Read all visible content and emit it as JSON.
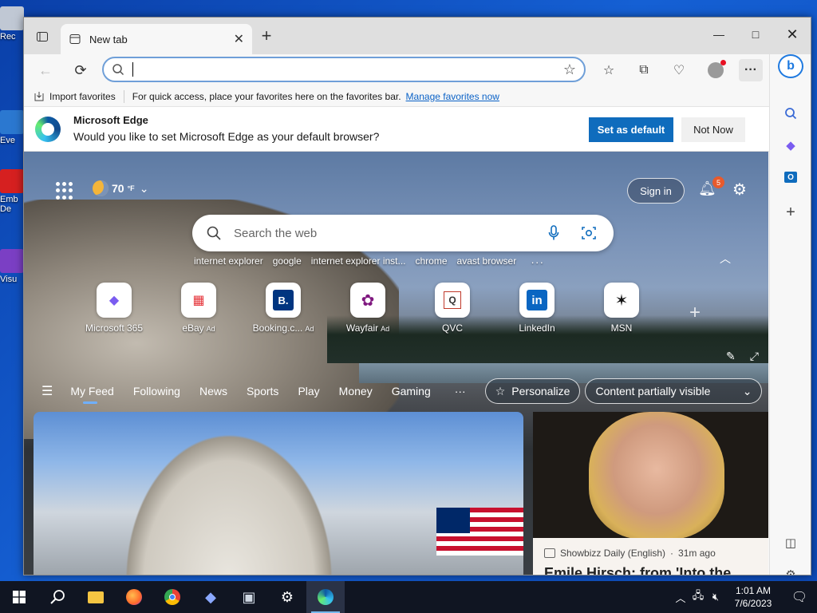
{
  "desktop": {
    "icons": [
      {
        "label": "Rec",
        "color": "#c0c8d4"
      },
      {
        "label": "Eve",
        "color": "#2b78d0"
      },
      {
        "label": "Emb De",
        "color": "#d62020"
      },
      {
        "label": "Visu",
        "color": "#7b3fc4"
      }
    ]
  },
  "browser": {
    "tab": {
      "title": "New tab"
    },
    "omnibox": {
      "value": "",
      "placeholder": ""
    },
    "favorites_bar": {
      "import_label": "Import favorites",
      "hint": "For quick access, place your favorites here on the favorites bar.",
      "manage_link": "Manage favorites now"
    },
    "infobar": {
      "title": "Microsoft Edge",
      "message": "Would you like to set Microsoft Edge as your default browser?",
      "primary_button": "Set as default",
      "secondary_button": "Not Now"
    }
  },
  "newtab": {
    "weather": {
      "temp": "70",
      "unit": "°F"
    },
    "signin_label": "Sign in",
    "notification_count": "5",
    "search": {
      "placeholder": "Search the web"
    },
    "trending": [
      "internet explorer",
      "google",
      "internet explorer inst...",
      "chrome",
      "avast browser"
    ],
    "tiles": [
      {
        "label": "Microsoft 365",
        "ad": "",
        "icon": "microsoft-365-icon",
        "glyph": "◆",
        "color": "#7a5cf0"
      },
      {
        "label": "eBay",
        "ad": "Ad",
        "icon": "ebay-icon",
        "glyph": "▦",
        "color": "#e53238"
      },
      {
        "label": "Booking.c...",
        "ad": "Ad",
        "icon": "booking-icon",
        "glyph": "B.",
        "color": "#003580"
      },
      {
        "label": "Wayfair",
        "ad": "Ad",
        "icon": "wayfair-icon",
        "glyph": "✿",
        "color": "#7f187f"
      },
      {
        "label": "QVC",
        "ad": "",
        "icon": "qvc-icon",
        "glyph": "Q",
        "color": "#c0392b"
      },
      {
        "label": "LinkedIn",
        "ad": "",
        "icon": "linkedin-icon",
        "glyph": "in",
        "color": "#0a66c2"
      },
      {
        "label": "MSN",
        "ad": "",
        "icon": "msn-icon",
        "glyph": "✶",
        "color": "#111111"
      }
    ],
    "feed_nav": {
      "items": [
        "My Feed",
        "Following",
        "News",
        "Sports",
        "Play",
        "Money",
        "Gaming"
      ],
      "active": "My Feed",
      "personalize": "Personalize",
      "visibility": "Content partially visible"
    },
    "cards": [
      {
        "source": "Showbizz Daily (English)",
        "age": "31m ago",
        "headline": "Emile Hirsch: from 'Into the"
      }
    ]
  },
  "taskbar": {
    "time": "1:01 AM",
    "date": "7/6/2023"
  }
}
